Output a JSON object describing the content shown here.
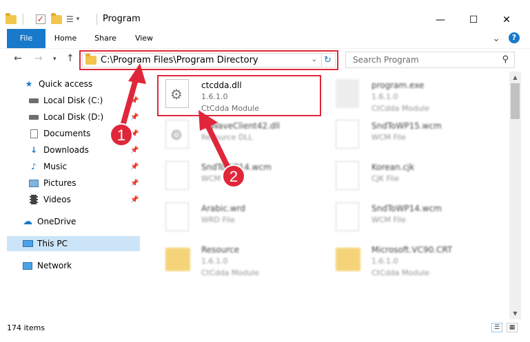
{
  "window": {
    "title": "Program",
    "minimize": "—",
    "maximize": "☐",
    "close": "✕"
  },
  "ribbon": {
    "tabs": [
      "File",
      "Home",
      "Share",
      "View"
    ],
    "help": "?",
    "expand": "⌄"
  },
  "address": {
    "path": "C:\\Program Files\\Program Directory",
    "search_placeholder": "Search Program"
  },
  "sidebar": {
    "items": [
      {
        "label": "Quick access",
        "icon": "star-icon"
      },
      {
        "label": "Local Disk (C:)",
        "icon": "drive-icon"
      },
      {
        "label": "Local Disk (D:)",
        "icon": "drive-icon"
      },
      {
        "label": "Documents",
        "icon": "documents-icon"
      },
      {
        "label": "Downloads",
        "icon": "download-icon"
      },
      {
        "label": "Music",
        "icon": "music-icon"
      },
      {
        "label": "Pictures",
        "icon": "pictures-icon"
      },
      {
        "label": "Videos",
        "icon": "videos-icon"
      },
      {
        "label": "OneDrive",
        "icon": "cloud-icon"
      },
      {
        "label": "This PC",
        "icon": "computer-icon"
      },
      {
        "label": "Network",
        "icon": "network-icon"
      }
    ]
  },
  "files": [
    {
      "name": "ctcdda.dll",
      "line2": "1.6.1.0",
      "line3": "CtCdda Module"
    },
    {
      "name": "program.exe",
      "line2": "1.6.1.0",
      "line3": "CtCdda Module"
    },
    {
      "name": "CtWaveClient42.dll",
      "line2": "Resource DLL",
      "line3": ""
    },
    {
      "name": "SndToWP15.wcm",
      "line2": "WCM File",
      "line3": ""
    },
    {
      "name": "SndToWP14.wcm",
      "line2": "WCM File",
      "line3": ""
    },
    {
      "name": "Korean.cjk",
      "line2": "CJK File",
      "line3": ""
    },
    {
      "name": "Arabic.wrd",
      "line2": "WRD File",
      "line3": ""
    },
    {
      "name": "SndToWP14.wcm",
      "line2": "WCM File",
      "line3": ""
    },
    {
      "name": "Resource",
      "line2": "1.6.1.0",
      "line3": "CtCdda Module"
    },
    {
      "name": "Microsoft.VC90.CRT",
      "line2": "1.6.1.0",
      "line3": "CtCdda Module"
    }
  ],
  "status": {
    "count": "174 items"
  },
  "annotations": {
    "badge1": "1",
    "badge2": "2"
  },
  "colors": {
    "accent": "#1979ca",
    "highlight": "#e0263a",
    "selected": "#cce4f7"
  }
}
